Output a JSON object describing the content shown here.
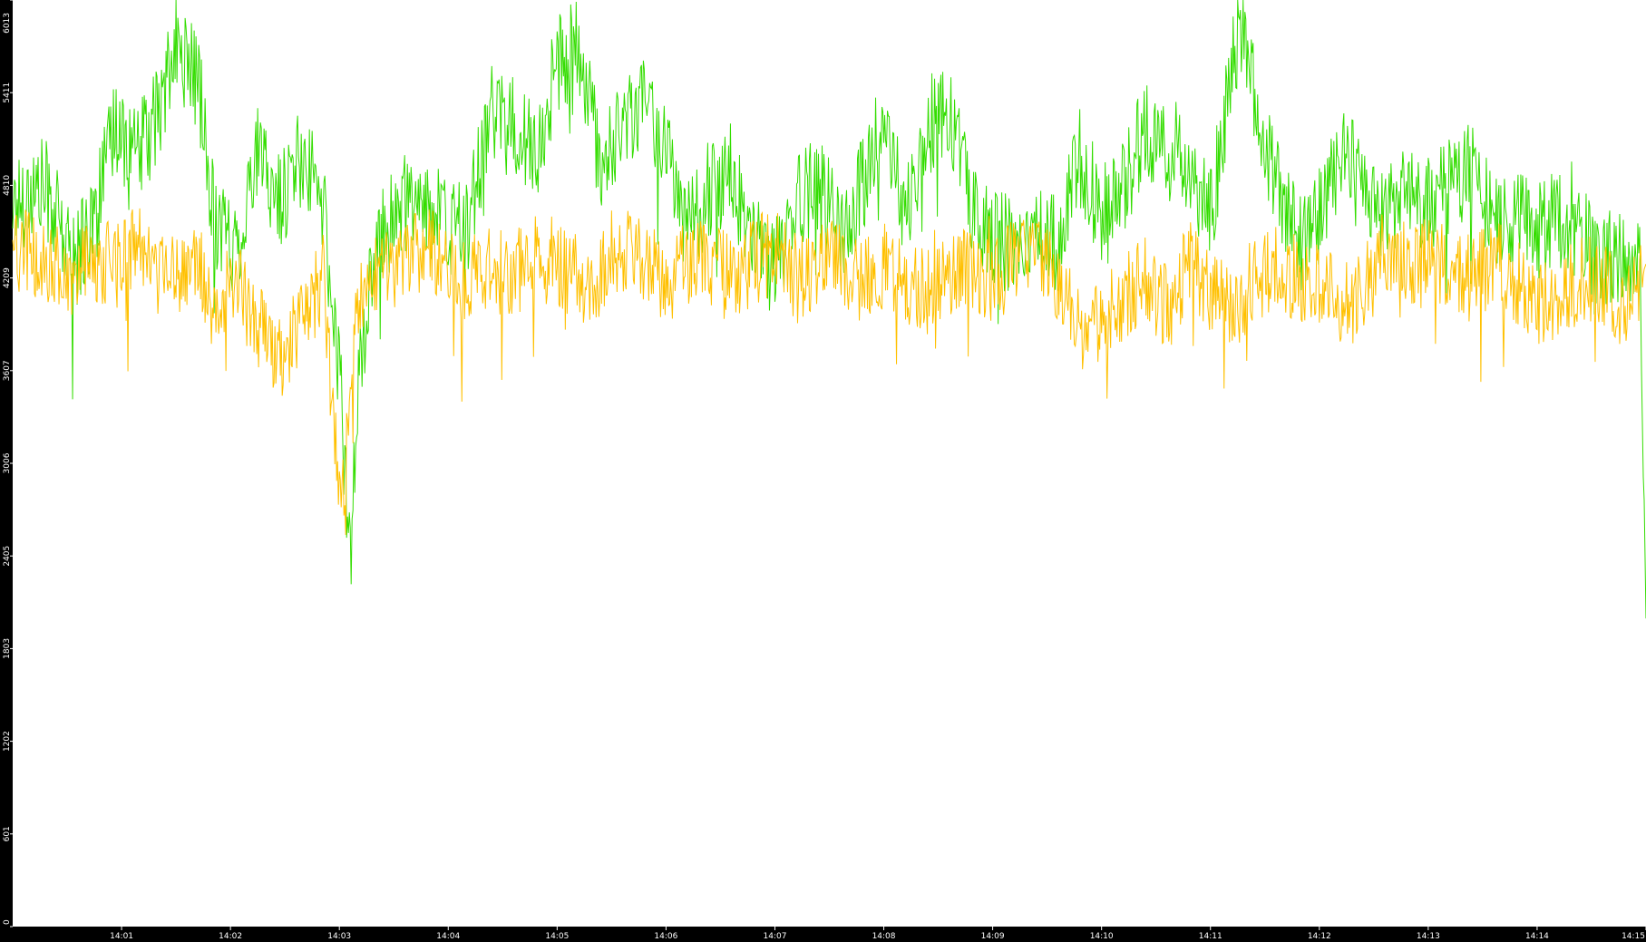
{
  "chart_data": {
    "type": "line",
    "background_color": "#000000",
    "plot_background_color": "#ffffff",
    "grid": false,
    "legend": "none",
    "ylim": [
      0,
      6013
    ],
    "y_ticks": [
      "0",
      "601",
      "1202",
      "1803",
      "2405",
      "3006",
      "3607",
      "4209",
      "4810",
      "5411",
      "6013"
    ],
    "x_ticks": [
      "14:01",
      "14:02",
      "14:03",
      "14:04",
      "14:05",
      "14:06",
      "14:07",
      "14:08",
      "14:09",
      "14:10",
      "14:11",
      "14:12",
      "14:13",
      "14:14",
      "14:15"
    ],
    "x_range_minutes": [
      0.0,
      15.0
    ],
    "series": [
      {
        "color": "#33dd00",
        "points": [
          [
            0.0,
            4700
          ],
          [
            0.3,
            4800
          ],
          [
            0.55,
            4300
          ],
          [
            0.75,
            4600
          ],
          [
            0.95,
            5200
          ],
          [
            1.15,
            5000
          ],
          [
            1.35,
            5300
          ],
          [
            1.5,
            5700
          ],
          [
            1.7,
            5500
          ],
          [
            1.85,
            4600
          ],
          [
            2.05,
            4400
          ],
          [
            2.25,
            5000
          ],
          [
            2.45,
            4700
          ],
          [
            2.65,
            5000
          ],
          [
            2.85,
            4700
          ],
          [
            3.02,
            3400
          ],
          [
            3.1,
            2400
          ],
          [
            3.2,
            3800
          ],
          [
            3.4,
            4500
          ],
          [
            3.6,
            4700
          ],
          [
            3.8,
            4700
          ],
          [
            4.0,
            4500
          ],
          [
            4.2,
            4600
          ],
          [
            4.4,
            5300
          ],
          [
            4.6,
            5200
          ],
          [
            4.8,
            5000
          ],
          [
            5.0,
            5600
          ],
          [
            5.2,
            5700
          ],
          [
            5.4,
            4900
          ],
          [
            5.6,
            5200
          ],
          [
            5.8,
            5400
          ],
          [
            6.0,
            5100
          ],
          [
            6.2,
            4500
          ],
          [
            6.4,
            4800
          ],
          [
            6.6,
            4900
          ],
          [
            6.8,
            4400
          ],
          [
            7.0,
            4300
          ],
          [
            7.2,
            4700
          ],
          [
            7.4,
            4800
          ],
          [
            7.6,
            4500
          ],
          [
            7.8,
            4800
          ],
          [
            8.0,
            5200
          ],
          [
            8.2,
            4600
          ],
          [
            8.4,
            5200
          ],
          [
            8.6,
            5300
          ],
          [
            8.8,
            4700
          ],
          [
            9.0,
            4500
          ],
          [
            9.2,
            4400
          ],
          [
            9.4,
            4600
          ],
          [
            9.6,
            4400
          ],
          [
            9.8,
            5000
          ],
          [
            10.0,
            4600
          ],
          [
            10.2,
            4800
          ],
          [
            10.4,
            5200
          ],
          [
            10.6,
            5000
          ],
          [
            10.8,
            4900
          ],
          [
            11.0,
            4600
          ],
          [
            11.2,
            5600
          ],
          [
            11.3,
            5900
          ],
          [
            11.4,
            5400
          ],
          [
            11.6,
            4800
          ],
          [
            11.8,
            4400
          ],
          [
            12.0,
            4600
          ],
          [
            12.2,
            5000
          ],
          [
            12.4,
            4900
          ],
          [
            12.6,
            4600
          ],
          [
            12.8,
            4800
          ],
          [
            13.0,
            4700
          ],
          [
            13.2,
            4800
          ],
          [
            13.4,
            4900
          ],
          [
            13.6,
            4600
          ],
          [
            13.8,
            4600
          ],
          [
            14.0,
            4500
          ],
          [
            14.2,
            4600
          ],
          [
            14.4,
            4500
          ],
          [
            14.6,
            4300
          ],
          [
            14.8,
            4400
          ],
          [
            14.95,
            4300
          ],
          [
            15.0,
            2000
          ]
        ]
      },
      {
        "color": "#ffc000",
        "points": [
          [
            0.0,
            4400
          ],
          [
            0.3,
            4300
          ],
          [
            0.55,
            4200
          ],
          [
            0.75,
            4300
          ],
          [
            0.95,
            4300
          ],
          [
            1.15,
            4400
          ],
          [
            1.35,
            4200
          ],
          [
            1.5,
            4200
          ],
          [
            1.7,
            4300
          ],
          [
            1.85,
            4000
          ],
          [
            2.05,
            4200
          ],
          [
            2.25,
            3900
          ],
          [
            2.45,
            3700
          ],
          [
            2.65,
            3900
          ],
          [
            2.85,
            4200
          ],
          [
            3.02,
            2600
          ],
          [
            3.1,
            3600
          ],
          [
            3.2,
            4100
          ],
          [
            3.4,
            4300
          ],
          [
            3.6,
            4300
          ],
          [
            3.8,
            4400
          ],
          [
            4.0,
            4300
          ],
          [
            4.2,
            4200
          ],
          [
            4.4,
            4300
          ],
          [
            4.6,
            4200
          ],
          [
            4.8,
            4400
          ],
          [
            5.0,
            4300
          ],
          [
            5.2,
            4200
          ],
          [
            5.4,
            4200
          ],
          [
            5.6,
            4400
          ],
          [
            5.8,
            4300
          ],
          [
            6.0,
            4200
          ],
          [
            6.2,
            4300
          ],
          [
            6.4,
            4300
          ],
          [
            6.6,
            4200
          ],
          [
            6.8,
            4300
          ],
          [
            7.0,
            4400
          ],
          [
            7.2,
            4200
          ],
          [
            7.4,
            4300
          ],
          [
            7.6,
            4300
          ],
          [
            7.8,
            4200
          ],
          [
            8.0,
            4300
          ],
          [
            8.2,
            4200
          ],
          [
            8.4,
            4100
          ],
          [
            8.6,
            4200
          ],
          [
            8.8,
            4300
          ],
          [
            9.0,
            4200
          ],
          [
            9.2,
            4300
          ],
          [
            9.4,
            4300
          ],
          [
            9.6,
            4200
          ],
          [
            9.8,
            3900
          ],
          [
            10.0,
            3900
          ],
          [
            10.2,
            4100
          ],
          [
            10.4,
            4200
          ],
          [
            10.6,
            4000
          ],
          [
            10.8,
            4300
          ],
          [
            11.0,
            4100
          ],
          [
            11.2,
            4000
          ],
          [
            11.3,
            4100
          ],
          [
            11.4,
            4200
          ],
          [
            11.6,
            4300
          ],
          [
            11.8,
            4200
          ],
          [
            12.0,
            4200
          ],
          [
            12.2,
            4000
          ],
          [
            12.4,
            4100
          ],
          [
            12.6,
            4400
          ],
          [
            12.8,
            4300
          ],
          [
            13.0,
            4300
          ],
          [
            13.2,
            4300
          ],
          [
            13.4,
            4200
          ],
          [
            13.6,
            4300
          ],
          [
            13.8,
            4200
          ],
          [
            14.0,
            4000
          ],
          [
            14.2,
            4100
          ],
          [
            14.4,
            4200
          ],
          [
            14.6,
            4200
          ],
          [
            14.8,
            4000
          ],
          [
            14.95,
            4200
          ],
          [
            15.0,
            4300
          ]
        ]
      }
    ]
  }
}
